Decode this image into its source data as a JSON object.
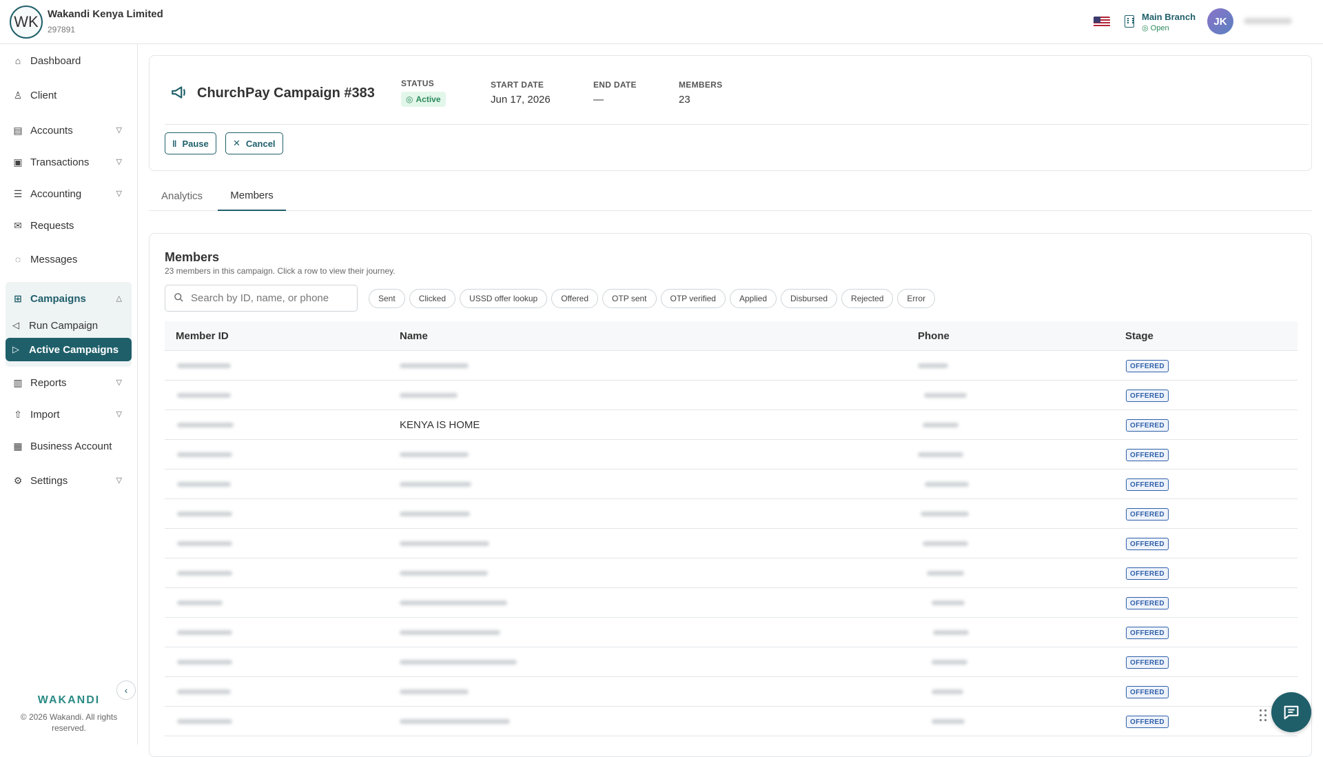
{
  "org": {
    "initials": "WK",
    "name": "Wakandi Kenya Limited",
    "id": "297891"
  },
  "header": {
    "branch_name": "Main Branch",
    "branch_status": "Open",
    "user_initials": "JK"
  },
  "sidebar": {
    "items": [
      {
        "label": "Dashboard"
      },
      {
        "label": "Client"
      },
      {
        "label": "Accounts"
      },
      {
        "label": "Transactions"
      },
      {
        "label": "Accounting"
      },
      {
        "label": "Requests"
      },
      {
        "label": "Messages"
      },
      {
        "label": "Campaigns"
      },
      {
        "label": "Run Campaign"
      },
      {
        "label": "Active Campaigns"
      },
      {
        "label": "Reports"
      },
      {
        "label": "Import"
      },
      {
        "label": "Business Account"
      },
      {
        "label": "Settings"
      }
    ],
    "brand": "WAKANDI",
    "copyright": "© 2026 Wakandi. All rights reserved."
  },
  "campaign": {
    "title": "ChurchPay Campaign #383",
    "status_label": "STATUS",
    "status_value": "Active",
    "start_label": "START DATE",
    "start_value": "Jun 17, 2026",
    "end_label": "END DATE",
    "end_value": "—",
    "members_label": "MEMBERS",
    "members_value": "23",
    "pause_label": "Pause",
    "cancel_label": "Cancel"
  },
  "tabs": [
    {
      "label": "Analytics"
    },
    {
      "label": "Members"
    }
  ],
  "members": {
    "title": "Members",
    "subtitle": "23 members in this campaign. Click a row to view their journey.",
    "search_placeholder": "Search by ID, name, or phone",
    "filters": [
      "Sent",
      "Clicked",
      "USSD offer lookup",
      "Offered",
      "OTP sent",
      "OTP verified",
      "Applied",
      "Disbursed",
      "Rejected",
      "Error"
    ],
    "columns": [
      "Member ID",
      "Name",
      "Phone",
      "Stage"
    ],
    "rows": [
      {
        "name": "",
        "stage": "OFFERED"
      },
      {
        "name": "",
        "stage": "OFFERED"
      },
      {
        "name": "KENYA IS HOME",
        "stage": "OFFERED"
      },
      {
        "name": "",
        "stage": "OFFERED"
      },
      {
        "name": "",
        "stage": "OFFERED"
      },
      {
        "name": "",
        "stage": "OFFERED"
      },
      {
        "name": "",
        "stage": "OFFERED"
      },
      {
        "name": "",
        "stage": "OFFERED"
      },
      {
        "name": "",
        "stage": "OFFERED"
      },
      {
        "name": "",
        "stage": "OFFERED"
      },
      {
        "name": "",
        "stage": "OFFERED"
      },
      {
        "name": "",
        "stage": "OFFERED"
      },
      {
        "name": "",
        "stage": "OFFERED"
      }
    ]
  },
  "icons": {
    "dashboard": "home-icon",
    "client": "user-icon",
    "accounts": "wallet-icon",
    "transactions": "cash-icon",
    "accounting": "ledger-icon",
    "requests": "mail-icon",
    "messages": "chat-icon",
    "campaigns": "grid-icon",
    "run_campaign": "megaphone-icon",
    "active_campaigns": "play-icon",
    "reports": "bar-chart-icon",
    "import": "upload-icon",
    "business_account": "briefcase-icon",
    "settings": "gear-icon"
  },
  "colors": {
    "primary": "#1f5f6a",
    "active_badge_bg": "#e3f6ea",
    "active_badge_text": "#2b8a5c",
    "stage_badge": "#2f5fa8"
  }
}
